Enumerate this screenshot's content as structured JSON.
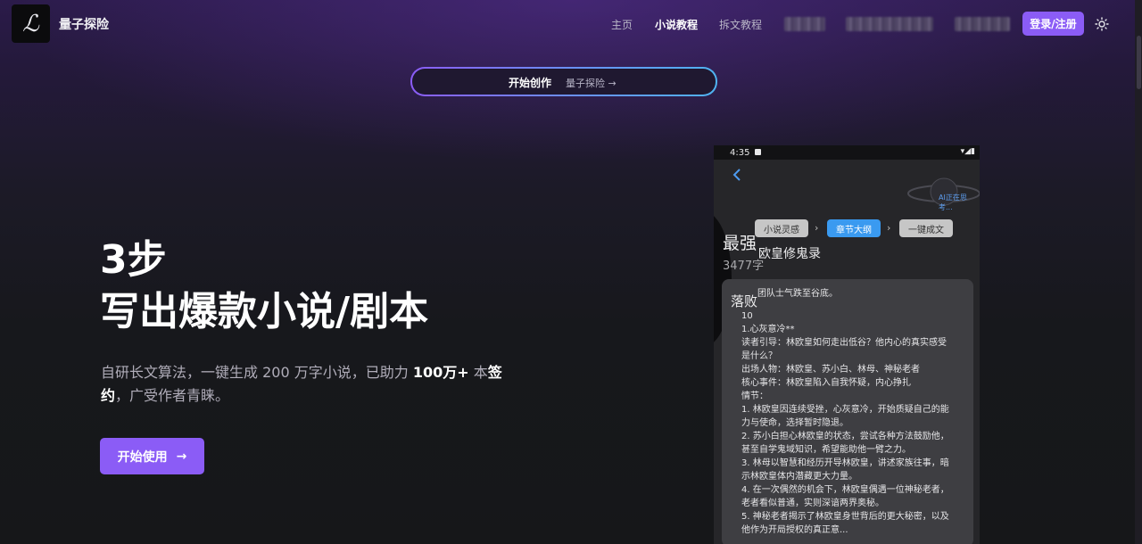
{
  "nav": {
    "logo_glyph": "ℒ",
    "brand": "量子探险",
    "links": [
      "主页",
      "小说教程",
      "拆文教程"
    ],
    "login": "登录/注册",
    "theme_icon": "sun-icon"
  },
  "banner": {
    "main": "开始创作",
    "sub": "量子探险 →"
  },
  "hero": {
    "line1": "3步",
    "line2": "写出爆款小说/剧本",
    "desc_a": "自研长文算法，一键生成 200 万字小说，已助力 ",
    "desc_bold1": "100万+",
    "desc_b": " 本",
    "desc_bold2": "签约",
    "desc_c": "，广受作者青睐。",
    "cta": "开始使用",
    "cta_arrow": "→"
  },
  "phone": {
    "time": "4:35",
    "status_icons": "▾◢▮",
    "thinking": "AI正在思考...",
    "steps": [
      "小说灵感",
      "章节大纲",
      "一键成文"
    ],
    "title": "最强",
    "novel": "欧皇修鬼录",
    "count": "3477字",
    "card_tag": "落败",
    "first_line": "团队士气跌至谷底。",
    "lines": [
      "",
      "",
      "10",
      "1.心灰意冷**",
      "读者引导：林欧皇如何走出低谷？他内心的真实感受",
      "是什么？",
      "出场人物：林欧皇、苏小白、林母、神秘老者",
      "核心事件：林欧皇陷入自我怀疑，内心挣扎",
      "情节：",
      "1. 林欧皇因连续受挫，心灰意冷，开始质疑自己的能",
      "力与使命，选择暂时隐退。",
      "2. 苏小白担心林欧皇的状态，尝试各种方法鼓励他，",
      "甚至自学鬼域知识，希望能助他一臂之力。",
      "3. 林母以智慧和经历开导林欧皇，讲述家族往事，暗",
      "示林欧皇体内潜藏更大力量。",
      "4. 在一次偶然的机会下，林欧皇偶遇一位神秘老者，",
      "老者看似普通，实则深谙两界奥秘。",
      "5. 神秘老者揭示了林欧皇身世背后的更大秘密，以及",
      "他作为开局授权的真正意..."
    ]
  }
}
